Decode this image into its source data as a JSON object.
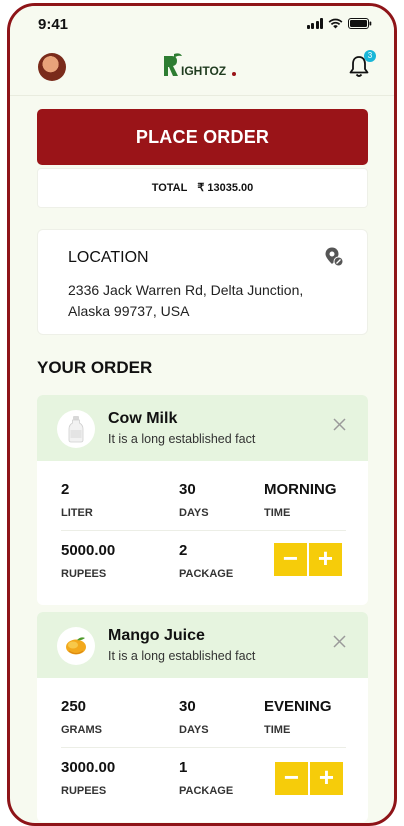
{
  "status_bar": {
    "time": "9:41"
  },
  "header": {
    "brand": "RIGHTOZ",
    "notification_count": "3"
  },
  "summary": {
    "place_order_label": "PLACE ORDER",
    "total_label": "TOTAL",
    "total_value": "₹ 13035.00"
  },
  "location": {
    "title": "LOCATION",
    "address": "2336 Jack Warren Rd, Delta Junction, Alaska 99737, USA"
  },
  "order_section_title": "YOUR ORDER",
  "orders": [
    {
      "name": "Cow Milk",
      "description": "It is a long established fact",
      "quantity": "2",
      "quantity_unit": "LITER",
      "days": "30",
      "days_label": "DAYS",
      "time": "MORNING",
      "time_label": "TIME",
      "price": "5000.00",
      "price_label": "RUPEES",
      "packages": "2",
      "packages_label": "PACKAGE",
      "minus_label": "−",
      "plus_label": "+"
    },
    {
      "name": "Mango Juice",
      "description": "It is a long established fact",
      "quantity": "250",
      "quantity_unit": "GRAMS",
      "days": "30",
      "days_label": "DAYS",
      "time": "EVENING",
      "time_label": "TIME",
      "price": "3000.00",
      "price_label": "RUPEES",
      "packages": "1",
      "packages_label": "PACKAGE",
      "minus_label": "−",
      "plus_label": "+"
    }
  ],
  "icons": {
    "avatar": "user-avatar",
    "notification": "bell-icon",
    "location": "location-pin-icon",
    "close": "close-icon",
    "milk": "milk-bottle-icon",
    "mango": "mango-icon"
  },
  "colors": {
    "brand_red": "#9a1418",
    "brand_green": "#2e7d32",
    "card_header_green": "#e6f4df",
    "stepper_yellow": "#f6cc0a"
  }
}
